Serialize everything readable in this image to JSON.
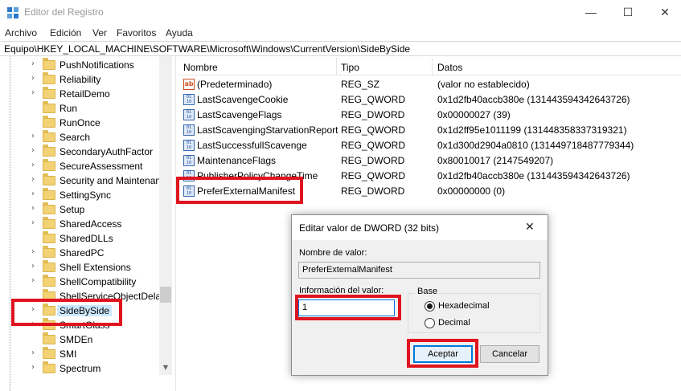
{
  "window": {
    "title": "Editor del Registro",
    "controls": {
      "minimize": "—",
      "maximize": "☐",
      "close": "✕"
    }
  },
  "menu": [
    "Archivo",
    "Edición",
    "Ver",
    "Favoritos",
    "Ayuda"
  ],
  "address": "Equipo\\HKEY_LOCAL_MACHINE\\SOFTWARE\\Microsoft\\Windows\\CurrentVersion\\SideBySide",
  "tree": {
    "items": [
      {
        "label": "PushNotifications",
        "selected": false
      },
      {
        "label": "Reliability",
        "selected": false
      },
      {
        "label": "RetailDemo",
        "selected": false
      },
      {
        "label": "Run",
        "selected": false
      },
      {
        "label": "RunOnce",
        "selected": false
      },
      {
        "label": "Search",
        "selected": false
      },
      {
        "label": "SecondaryAuthFactor",
        "selected": false
      },
      {
        "label": "SecureAssessment",
        "selected": false
      },
      {
        "label": "Security and Maintenan",
        "selected": false
      },
      {
        "label": "SettingSync",
        "selected": false
      },
      {
        "label": "Setup",
        "selected": false
      },
      {
        "label": "SharedAccess",
        "selected": false
      },
      {
        "label": "SharedDLLs",
        "selected": false
      },
      {
        "label": "SharedPC",
        "selected": false
      },
      {
        "label": "Shell Extensions",
        "selected": false
      },
      {
        "label": "ShellCompatibility",
        "selected": false
      },
      {
        "label": "ShellServiceObjectDelay",
        "selected": false
      },
      {
        "label": "SideBySide",
        "selected": true
      },
      {
        "label": "SmartGlass",
        "selected": false
      },
      {
        "label": "SMDEn",
        "selected": false
      },
      {
        "label": "SMI",
        "selected": false
      },
      {
        "label": "Spectrum",
        "selected": false
      }
    ]
  },
  "list": {
    "columns": {
      "name": "Nombre",
      "type": "Tipo",
      "data": "Datos"
    },
    "rows": [
      {
        "icon": "string-value-icon",
        "name": "(Predeterminado)",
        "type": "REG_SZ",
        "data": "(valor no establecido)"
      },
      {
        "icon": "binary-value-icon",
        "name": "LastScavengeCookie",
        "type": "REG_QWORD",
        "data": "0x1d2fb40accb380e (131443594342643726)"
      },
      {
        "icon": "binary-value-icon",
        "name": "LastScavengeFlags",
        "type": "REG_DWORD",
        "data": "0x00000027 (39)"
      },
      {
        "icon": "binary-value-icon",
        "name": "LastScavengingStarvationReport",
        "type": "REG_QWORD",
        "data": "0x1d2ff95e1011199 (131448358337319321)"
      },
      {
        "icon": "binary-value-icon",
        "name": "LastSuccessfullScavenge",
        "type": "REG_QWORD",
        "data": "0x1d300d2904a0810 (131449718487779344)"
      },
      {
        "icon": "binary-value-icon",
        "name": "MaintenanceFlags",
        "type": "REG_DWORD",
        "data": "0x80010017 (2147549207)"
      },
      {
        "icon": "binary-value-icon",
        "name": "PublisherPolicyChangeTime",
        "type": "REG_QWORD",
        "data": "0x1d2fb40accb380e (131443594342643726)"
      },
      {
        "icon": "binary-value-icon",
        "name": "PreferExternalManifest",
        "type": "REG_DWORD",
        "data": "0x00000000 (0)"
      }
    ]
  },
  "dialog": {
    "title": "Editar valor de DWORD (32 bits)",
    "close": "✕",
    "name_label": "Nombre de valor:",
    "name_value": "PreferExternalManifest",
    "data_label": "Información del valor:",
    "data_value": "1",
    "base_label": "Base",
    "radio_hex": "Hexadecimal",
    "radio_dec": "Decimal",
    "base_selected": "Hexadecimal",
    "ok": "Aceptar",
    "cancel": "Cancelar"
  },
  "colors": {
    "highlight": "#e0141e",
    "selection": "#cce8ff",
    "accent": "#0078d7"
  }
}
